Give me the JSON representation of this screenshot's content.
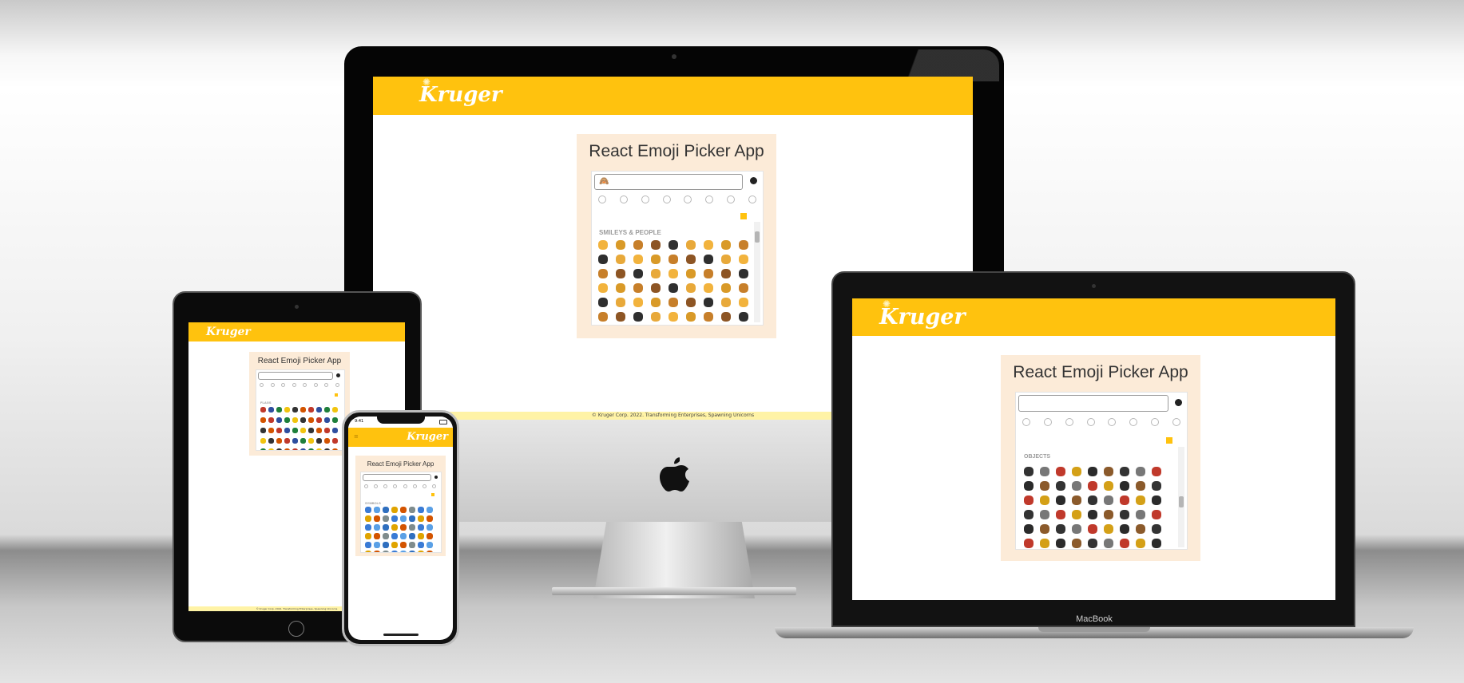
{
  "brand": {
    "logo_text": "Kruger",
    "accent": "#ffc20e",
    "card_bg": "#fcebd8"
  },
  "app": {
    "title": "React Emoji Picker App",
    "selected_emoji": "🙈"
  },
  "imac": {
    "section_label": "SMILEYS & PEOPLE",
    "footer": "© Kruger Corp. 2022. Transforming Enterprises, Spawning Unicorns",
    "brand_icon": "apple-logo"
  },
  "macbook": {
    "section_label": "OBJECTS",
    "model_label": "MacBook"
  },
  "ipad": {
    "section_label": "FLAGS",
    "footer": "© Kruger Corp. 2022. Transforming Enterprises, Spawning Unicorns"
  },
  "iphone": {
    "section_label": "SYMBOLS",
    "status_time": "9:41"
  },
  "categories": [
    "smileys-people",
    "animals-nature",
    "food-drink",
    "travel-places",
    "activities",
    "objects",
    "symbols",
    "flags"
  ],
  "emoji_palettes": {
    "people": [
      "#f2b33d",
      "#d99a28",
      "#c77f2a",
      "#8d5524",
      "#2f2f2f",
      "#e8a93a"
    ],
    "objects": [
      "#333333",
      "#777777",
      "#c0392b",
      "#d4a017",
      "#2b2b2b",
      "#8b5a2b"
    ],
    "flags": [
      "#c0392b",
      "#2e4e9f",
      "#1e7f3b",
      "#f1c40f",
      "#333333",
      "#d35400"
    ],
    "symbols": [
      "#3a7bd5",
      "#5aa0e6",
      "#2f6fbf",
      "#e0a400",
      "#d35400",
      "#7f8c8d"
    ]
  }
}
